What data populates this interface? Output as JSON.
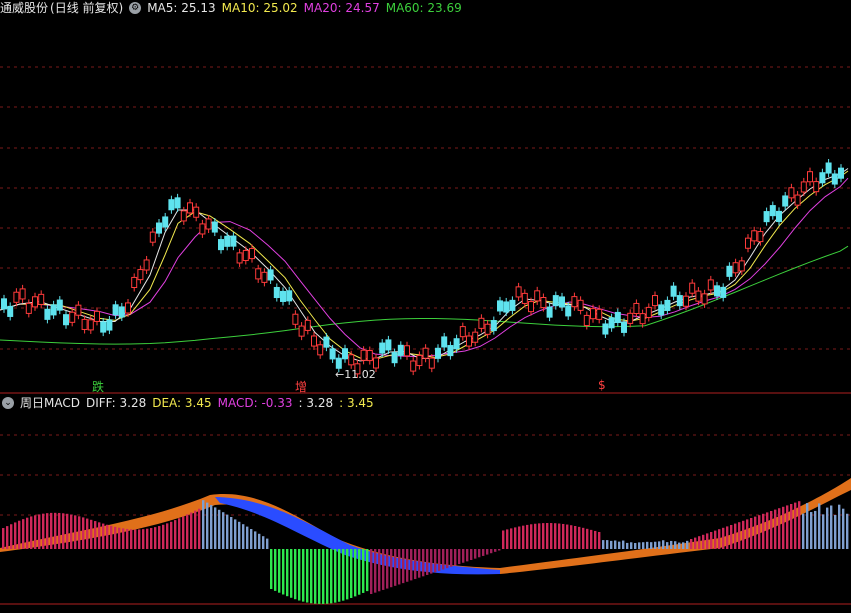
{
  "top_panel": {
    "stock_name": "通威股份",
    "period": "(日线 前复权)",
    "ma_legend": [
      {
        "label": "MA5: 25.13",
        "color": "#e6e6e6"
      },
      {
        "label": "MA10: 25.02",
        "color": "#f2e94e"
      },
      {
        "label": "MA20: 24.57",
        "color": "#e040e0"
      },
      {
        "label": "MA60: 23.69",
        "color": "#3ccf3c"
      }
    ],
    "markers": [
      {
        "text": "跌",
        "color": "#3ccf3c"
      },
      {
        "text": "增",
        "color": "#ff4040"
      },
      {
        "text": "$",
        "color": "#ff4040"
      }
    ],
    "low_label": "←11.02",
    "colors": {
      "up": "#ff3b3b",
      "down": "#5fe3ee",
      "grid": "#7a1a1a"
    }
  },
  "bottom_panel": {
    "indicator_period": "周日MACD",
    "values": [
      {
        "label": "DIFF: 3.28",
        "color": "#e6e6e6"
      },
      {
        "label": "DEA: 3.45",
        "color": "#f2e94e"
      },
      {
        "label": "MACD: -0.33",
        "color": "#e040e0"
      },
      {
        "label": ": 3.28",
        "color": "#e6e6e6"
      },
      {
        "label": ": 3.45",
        "color": "#f2e94e"
      }
    ],
    "colors": {
      "pos_bar": "#d0285a",
      "neg_bar": "#2ee84e",
      "neg_dark_bar": "#a0205a",
      "steel_bar": "#7f9fcf",
      "diff_band": "#e0701a",
      "dea_band": "#2a4cff"
    }
  },
  "chart_data": [
    {
      "type": "candlestick",
      "title": "通威股份 (日线 前复权)",
      "series": [
        {
          "name": "MA5",
          "latest": 25.13
        },
        {
          "name": "MA10",
          "latest": 25.02
        },
        {
          "name": "MA20",
          "latest": 24.57
        },
        {
          "name": "MA60",
          "latest": 23.69
        }
      ],
      "annotations": [
        "←11.02"
      ]
    },
    {
      "type": "bar",
      "title": "周日MACD",
      "series": [
        {
          "name": "DIFF",
          "latest": 3.28
        },
        {
          "name": "DEA",
          "latest": 3.45
        },
        {
          "name": "MACD",
          "latest": -0.33
        }
      ]
    }
  ]
}
